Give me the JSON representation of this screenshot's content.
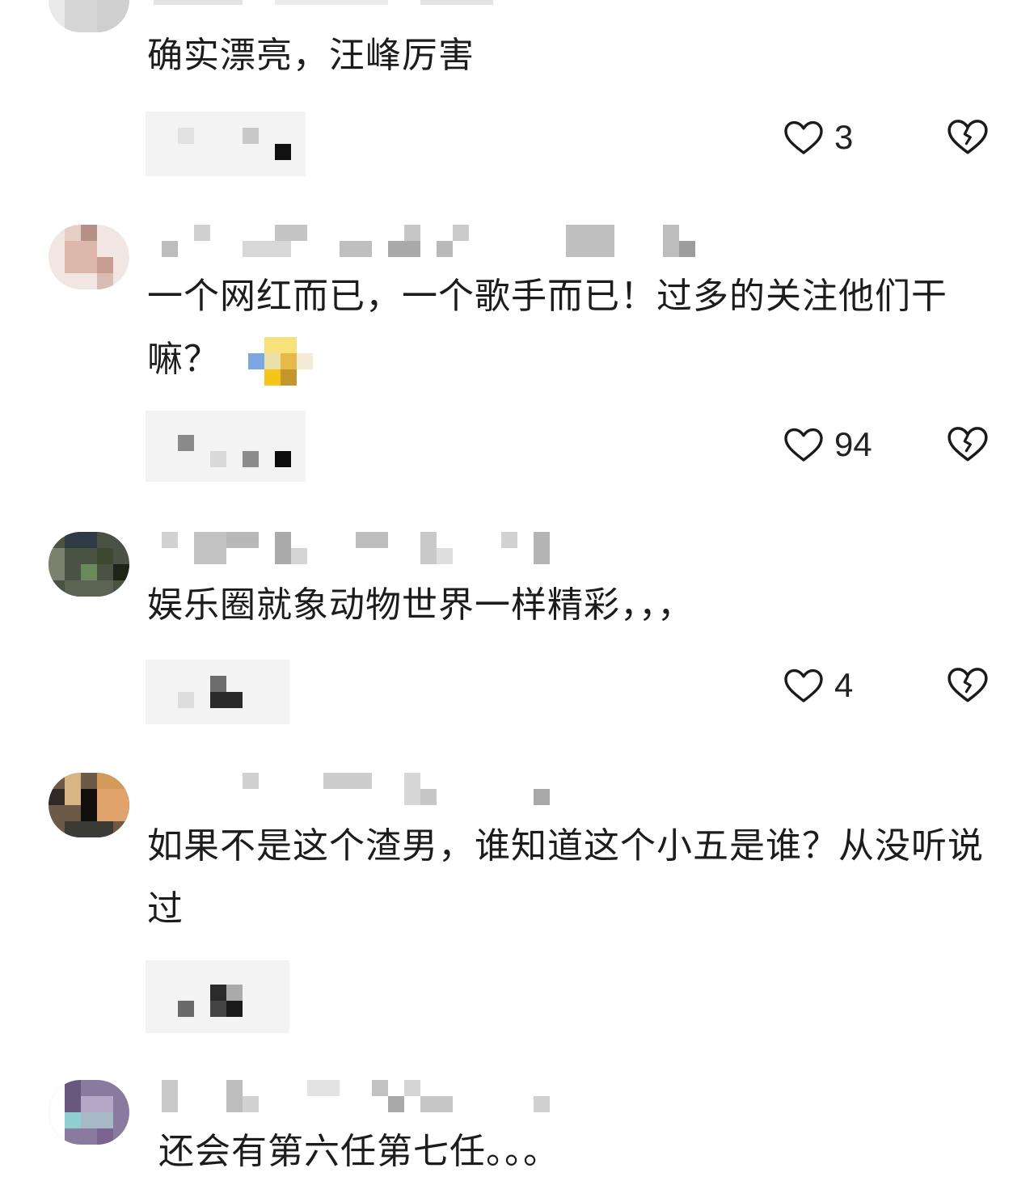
{
  "comments": [
    {
      "text": "确实漂亮，汪峰厉害",
      "likes": "3",
      "has_emoji": false
    },
    {
      "text": "一个网红而已，一个歌手而已！过多的关注他们干嘛？",
      "likes": "94",
      "has_emoji": true
    },
    {
      "text": "娱乐圈就象动物世界一样精彩，，，",
      "likes": "4",
      "has_emoji": false
    },
    {
      "text": "如果不是这个渣男，谁知道这个小五是谁？从没听说过",
      "likes": "",
      "has_emoji": false
    },
    {
      "text": "还会有第六任第七任。。。",
      "likes": "",
      "has_emoji": false
    }
  ],
  "icons": {
    "like": "heart-outline-icon",
    "dislike": "broken-heart-icon"
  },
  "colors": {
    "icon_stroke": "#1a1a1a",
    "pill_bg": "#f3f3f3"
  }
}
